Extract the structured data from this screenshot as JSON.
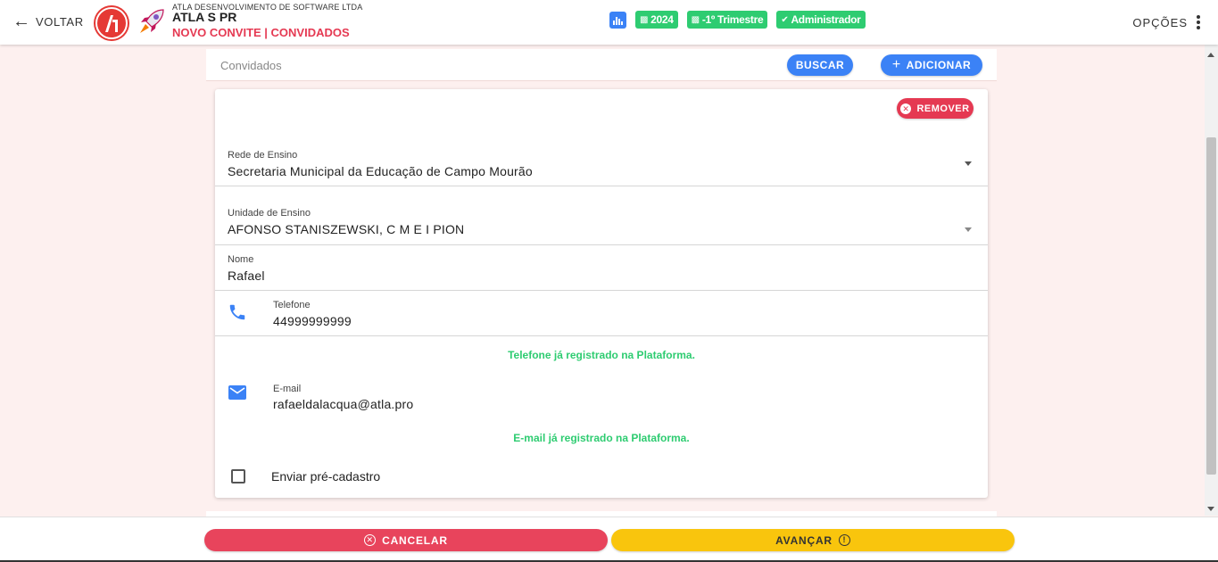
{
  "header": {
    "back_label": "VOLTAR",
    "company": "ATLA DESENVOLVIMENTO DE SOFTWARE LTDA",
    "school": "ATLA S PR",
    "subtitle": "NOVO CONVITE | CONVIDADOS",
    "chips": {
      "year": "2024",
      "period": "-1º Trimestre",
      "role": "Administrador"
    },
    "options_label": "OPÇÕES"
  },
  "guests": {
    "title": "Convidados",
    "search_label": "BUSCAR",
    "add_label": "ADICIONAR"
  },
  "guest_card": {
    "remove_label": "REMOVER",
    "rede": {
      "label": "Rede de Ensino",
      "value": "Secretaria Municipal da Educação de Campo Mourão"
    },
    "unidade": {
      "label": "Unidade de Ensino",
      "value": "AFONSO STANISZEWSKI, C M E I PION"
    },
    "nome": {
      "label": "Nome",
      "value": "Rafael"
    },
    "telefone": {
      "label": "Telefone",
      "value": "44999999999",
      "message": "Telefone já registrado na Plataforma."
    },
    "email": {
      "label": "E-mail",
      "value": "rafaeldalacqua@atla.pro",
      "message": "E-mail já registrado na Plataforma."
    },
    "pre_cadastro": {
      "label": "Enviar pré-cadastro",
      "checked": false
    }
  },
  "footer": {
    "cancel_label": "CANCELAR",
    "next_label": "AVANÇAR"
  },
  "colors": {
    "primary_blue": "#3b82f6",
    "success_green": "#2ecc71",
    "danger_red": "#e53952",
    "warning_yellow": "#f9c50d",
    "page_background": "#fdf0ef"
  },
  "icons": [
    "arrow-left-icon",
    "atla-logo",
    "rocket-icon",
    "bar-chart-icon",
    "calendar-icon",
    "check-circle-icon",
    "more-vert-icon",
    "plus-icon",
    "close-circle-icon",
    "chevron-down-icon",
    "phone-icon",
    "email-icon",
    "info-circle-icon"
  ]
}
